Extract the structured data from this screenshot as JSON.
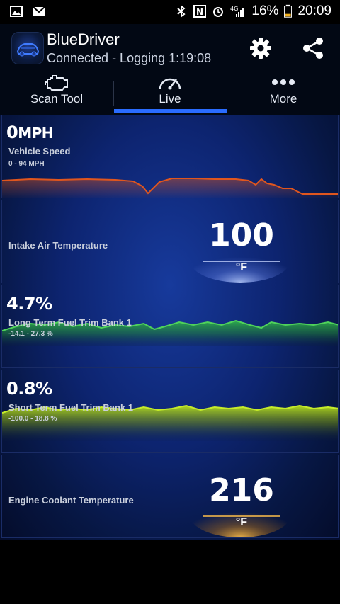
{
  "status_bar": {
    "battery": "16%",
    "time": "20:09"
  },
  "header": {
    "title": "BlueDriver",
    "subtitle": "Connected - Logging 1:19:08"
  },
  "tabs": [
    {
      "label": "Scan Tool",
      "icon": "engine-icon"
    },
    {
      "label": "Live",
      "icon": "speedometer-icon",
      "active": true
    },
    {
      "label": "More",
      "icon": "more-dots-icon"
    }
  ],
  "gauges": {
    "speed": {
      "value": "0",
      "unit": "MPH",
      "label": "Vehicle Speed",
      "range": "0 - 94 MPH"
    },
    "intake": {
      "label": "Intake Air Temperature",
      "value": "100",
      "unit": "°F"
    },
    "ltft": {
      "value": "4.7%",
      "label": "Long Term Fuel Trim Bank 1",
      "range": "-14.1 - 27.3 %"
    },
    "stft": {
      "value": "0.8%",
      "label": "Short Term Fuel Trim Bank 1",
      "range": "-100.0 - 18.8 %"
    },
    "coolant": {
      "label": "Engine Coolant Temperature",
      "value": "216",
      "unit": "°F"
    }
  },
  "colors": {
    "speed_line": "#e0561e",
    "ltft_line": "#3fbf3a",
    "stft_line": "#a8d61a",
    "intake_glow": "#8aa7ff",
    "coolant_glow": "#ffae22",
    "accent": "#2a6cff"
  }
}
